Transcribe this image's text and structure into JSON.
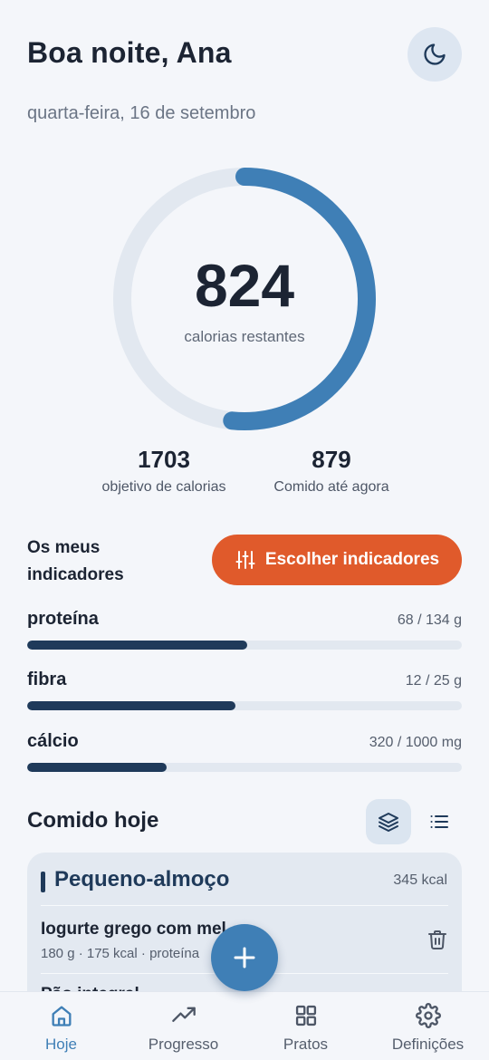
{
  "header": {
    "greeting": "Boa noite, Ana",
    "date": "quarta-feira, 16 de setembro",
    "theme_icon": "moon-icon"
  },
  "calories": {
    "remaining": "824",
    "remaining_label": "calorias restantes",
    "progress_fraction": 0.516,
    "goal_value": "1703",
    "goal_label": "objetivo de calorias",
    "eaten_value": "879",
    "eaten_label": "Comido até agora"
  },
  "indicators": {
    "title": "Os meus indicadores",
    "choose_label": "Escolher indicadores",
    "items": [
      {
        "name": "proteína",
        "amount": "68 / 134 g",
        "fraction": 0.507
      },
      {
        "name": "fibra",
        "amount": "12 / 25 g",
        "fraction": 0.48
      },
      {
        "name": "cálcio",
        "amount": "320 / 1000 mg",
        "fraction": 0.32
      }
    ]
  },
  "eaten_today": {
    "title": "Comido hoje",
    "meals": [
      {
        "name": "Pequeno-almoço",
        "kcal": "345 kcal",
        "foods": [
          {
            "name": "Iogurte grego com mel",
            "meta": "180 g · 175 kcal · proteína"
          },
          {
            "name": "Pão integral"
          }
        ]
      }
    ]
  },
  "nav": {
    "items": [
      {
        "label": "Hoje",
        "icon": "home-icon",
        "active": true
      },
      {
        "label": "Progresso",
        "icon": "trending-up-icon",
        "active": false
      },
      {
        "label": "Pratos",
        "icon": "grid-icon",
        "active": false
      },
      {
        "label": "Definições",
        "icon": "gear-icon",
        "active": false
      }
    ]
  },
  "colors": {
    "accent": "#3f7fb6",
    "cta": "#e05a2b",
    "bar_fill": "#1f3a5a",
    "track": "#e2e8f0"
  }
}
